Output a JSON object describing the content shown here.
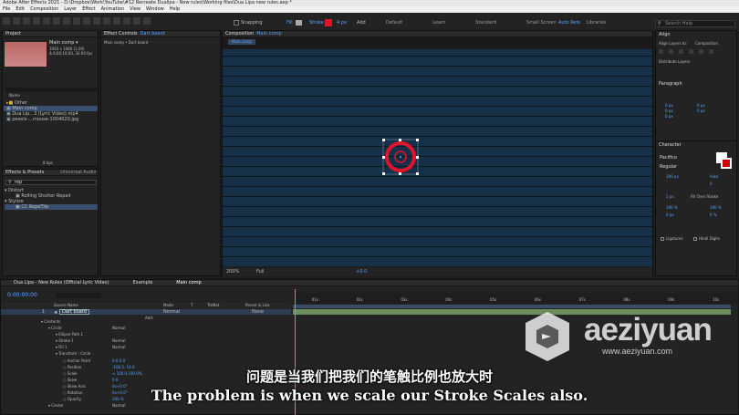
{
  "window": {
    "title": "Adobe After Effects 2021 - D:\\Dropbox\\Work\\YouTube\\#12 Recreate Dualipa - New rules\\Working files\\Dua Lipa new rules.aep *",
    "menus": [
      "File",
      "Edit",
      "Composition",
      "Layer",
      "Effect",
      "Animation",
      "View",
      "Window",
      "Help"
    ]
  },
  "toolbar": {
    "snapping": "Snapping",
    "fill": "Fill",
    "stroke": "Stroke",
    "stroke_width": "4 px",
    "add": "Add",
    "workspaces": [
      "Default",
      "Learn",
      "Standard",
      "Small Screen",
      "Libraries"
    ],
    "active_workspace": "Auto Rets",
    "search_help": "Search Help"
  },
  "project": {
    "tab": "Project",
    "comp_name": "Main comp ▾",
    "comp_info": [
      "1920 x 1080 (1.00)",
      "Δ 0;00;10;00, 30.00 fps"
    ],
    "col_name": "Name",
    "items": [
      {
        "name": "Other",
        "selected": false
      },
      {
        "name": "Main comp",
        "selected": true
      },
      {
        "name": "Dua Lip...3 (Lyric Video).mp4",
        "selected": false
      },
      {
        "name": "pexels-...mouse-1004020.jpg",
        "selected": false
      }
    ],
    "bpc": "8 bpc"
  },
  "effects": {
    "tab": "Effects & Presets",
    "tab2": "Universal Audio",
    "search": "rep",
    "groups": [
      {
        "name": "Distort",
        "item": "Rolling Shutter Repair"
      },
      {
        "name": "Stylize",
        "item": "CC RepeTile"
      }
    ]
  },
  "effect_controls": {
    "tab": "Effect Controls",
    "layer": "Dart board",
    "path": "Main comp • Dart board"
  },
  "composition": {
    "tab": "Composition",
    "name": "Main comp",
    "crumb": "Main comp",
    "zoom": "200%",
    "resolution": "Full",
    "exposure": "+0.0"
  },
  "align": {
    "title": "Align",
    "align_to_label": "Align Layers to:",
    "align_to": "Composition",
    "distribute": "Distribute Layers"
  },
  "paragraph": {
    "title": "Paragraph",
    "fields": [
      "0 px",
      "0 px",
      "0 px",
      "0 px",
      "0 px"
    ]
  },
  "character": {
    "title": "Character",
    "font": "Pacifico",
    "style": "Regular",
    "size": "100 px",
    "leading": "Auto",
    "tracking": "0",
    "stroke": "1 px",
    "stroke_mode": "Fill Over Stroke",
    "vscale": "100 %",
    "hscale": "100 %",
    "baseline": "0 px",
    "tsume": "0 %",
    "ligatures": "Ligatures",
    "hindi": "Hindi Digits"
  },
  "timeline": {
    "tabs": [
      "Dua Lipa - New Rules (Official Lyric Video)",
      "Example",
      "Main comp"
    ],
    "timecode": "0:00:00:00",
    "columns": [
      "Source Name",
      "Mode",
      "T",
      "TrkMat",
      "Parent & Link"
    ],
    "layer": {
      "index": "1",
      "name": "Dart board",
      "mode": "Normal",
      "parent": "None"
    },
    "props": [
      {
        "name": "Contents",
        "value": "",
        "level": 1
      },
      {
        "name": "Circle",
        "value": "Normal",
        "level": 2
      },
      {
        "name": "Ellipse Path 1",
        "value": "",
        "level": 3
      },
      {
        "name": "Stroke 1",
        "value": "Normal",
        "level": 3
      },
      {
        "name": "Fill 1",
        "value": "Normal",
        "level": 3
      },
      {
        "name": "Transform : Circle",
        "value": "",
        "level": 3
      },
      {
        "name": "Anchor Point",
        "value": "0.0,0.0",
        "level": 4
      },
      {
        "name": "Position",
        "value": "-106.5,-14.0",
        "level": 4
      },
      {
        "name": "Scale",
        "value": "∞ 100.0,100.0%",
        "level": 4
      },
      {
        "name": "Skew",
        "value": "0.0",
        "level": 4
      },
      {
        "name": "Skew Axis",
        "value": "0x+0.0°",
        "level": 4
      },
      {
        "name": "Rotation",
        "value": "0x+0.0°",
        "level": 4
      },
      {
        "name": "Opacity",
        "value": "100 %",
        "level": 4
      },
      {
        "name": "Center",
        "value": "Normal",
        "level": 2
      }
    ],
    "add": "Add:",
    "ruler": [
      "01s",
      "02s",
      "03s",
      "04s",
      "05s",
      "06s",
      "07s",
      "08s",
      "09s",
      "10s"
    ]
  },
  "subtitles": {
    "cn": "问题是当我们把我们的笔触比例也放大时",
    "en": "The problem is when we scale our Stroke Scales also."
  },
  "watermark": {
    "text": "aeziyuan",
    "url": "www.aeziyuan.com"
  },
  "colors": {
    "accent": "#5aa3ff",
    "target_red": "#e0142a",
    "wall": "#163048"
  }
}
